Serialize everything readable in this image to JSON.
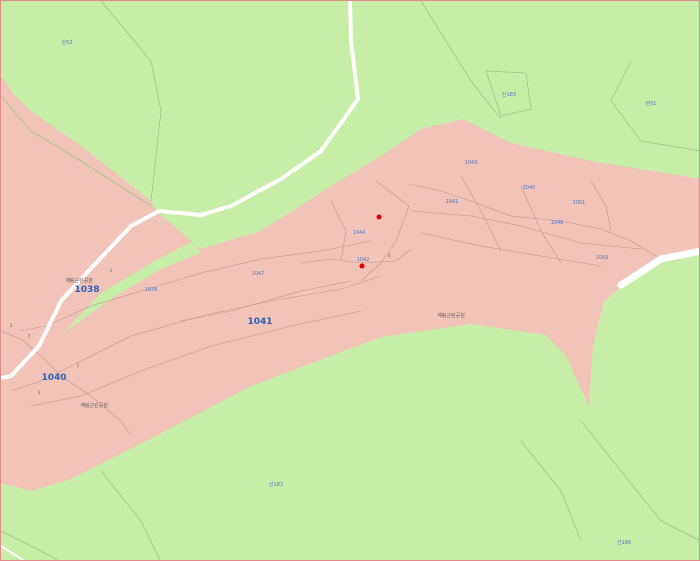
{
  "map": {
    "colors": {
      "background": "#c6eea6",
      "zone": "#f2c3b8",
      "parcel_line": "#bf9a8e",
      "green_line": "#9cc98a",
      "road": "#ffffff",
      "label_blue": "#4a78c8",
      "label_dark": "#5a5a5a",
      "marker": "#e00000",
      "frame": "#e08a8a"
    },
    "labels": {
      "park_a": "계림근린공원",
      "lot_1038": "1038",
      "lot_1040": "1040",
      "lot_1041": "1041",
      "park_b": "계림근린공원",
      "park_c": "계림근린공원",
      "parcel_top_left": "산52",
      "parcel_top_mid": "산183",
      "parcel_top_right": "산51",
      "parcel_1043": "1043",
      "parcel_1046": "1046",
      "parcel_1041b": "1041",
      "parcel_1051": "1051",
      "parcel_1048": "1048",
      "parcel_1050": "1050",
      "parcel_1044": "1044",
      "parcel_1042": "1042",
      "parcel_1047": "1047",
      "parcel_1039": "1039",
      "parcel_bottom_mid": "산183",
      "parcel_bottom_right": "산186",
      "small_a": "1",
      "small_b": "3",
      "small_c": "7",
      "small_d": "1",
      "small_e": "1",
      "small_f": "4"
    },
    "markers": [
      "location-marker-1",
      "location-marker-2"
    ]
  }
}
